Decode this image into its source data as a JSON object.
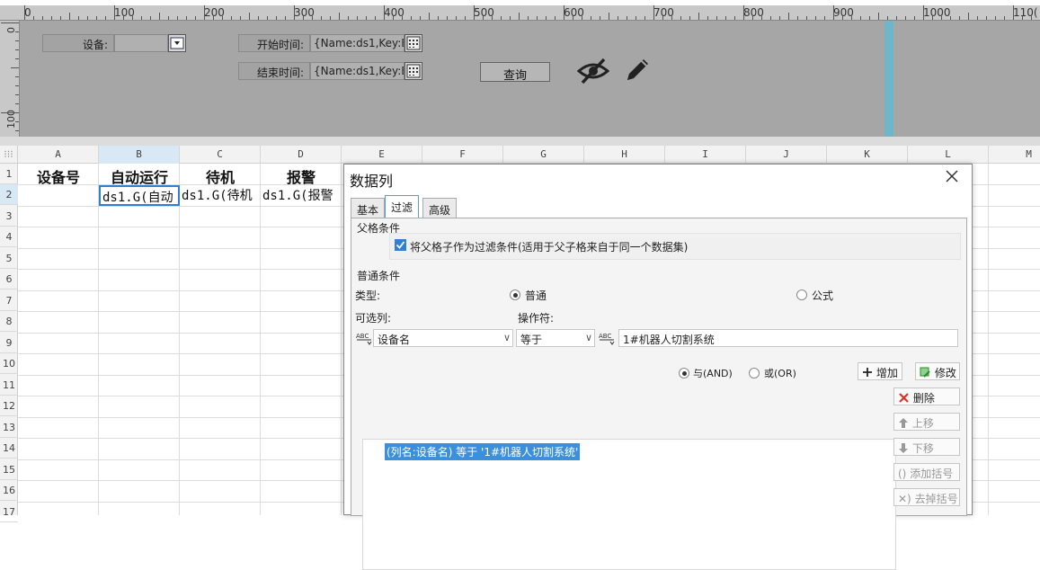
{
  "ruler": {
    "h_labels": [
      "0",
      "100",
      "200",
      "300",
      "400",
      "500",
      "600",
      "700",
      "800",
      "900",
      "1000",
      "110("
    ],
    "v_labels": [
      "0",
      "100"
    ]
  },
  "params": {
    "device_label": "设备:",
    "device_value": "",
    "start_label": "开始时间:",
    "start_value": "{Name:ds1,Key:E",
    "end_label": "结束时间:",
    "end_value": "{Name:ds1,Key:E",
    "query_label": "查询"
  },
  "sheet": {
    "columns": [
      "A",
      "B",
      "C",
      "D",
      "E",
      "F",
      "G",
      "H",
      "I",
      "J",
      "K",
      "L",
      "M"
    ],
    "rows": [
      "1",
      "2",
      "3",
      "4",
      "5",
      "6",
      "7",
      "8",
      "9",
      "10",
      "11",
      "12",
      "13",
      "14",
      "15",
      "16",
      "17"
    ],
    "header_cells": [
      "设备号",
      "自动运行",
      "待机",
      "报警"
    ],
    "data_cells": [
      "ds1.G(自动",
      "ds1.G(待机",
      "ds1.G(报警"
    ]
  },
  "dialog": {
    "title": "数据列",
    "tabs": [
      "基本",
      "过滤",
      "高级"
    ],
    "active_tab": "过滤",
    "parent_section": "父格条件",
    "parent_checkbox": "将父格子作为过滤条件(适用于父子格来自于同一个数据集)",
    "normal_section": "普通条件",
    "type_label": "类型:",
    "type_normal": "普通",
    "type_formula": "公式",
    "column_label": "可选列:",
    "operator_label": "操作符:",
    "column_value": "设备名",
    "operator_value": "等于",
    "condition_value": "1#机器人切割系统",
    "and_label": "与(AND)",
    "or_label": "或(OR)",
    "add_label": "增加",
    "modify_label": "修改",
    "delete_label": "删除",
    "up_label": "上移",
    "down_label": "下移",
    "add_bracket_label": "添加括号",
    "remove_bracket_label": "去掉括号",
    "condition_item": "(列名:设备名) 等于 '1#机器人切割系统'"
  },
  "colors": {
    "param_bg": "#a6a6a6",
    "accent": "#3c8fdb",
    "delete_red": "#d9342b",
    "blue_bar": "#6fb6c8"
  },
  "icons": [
    "hide-eye-icon",
    "pencil-icon",
    "calendar-icon",
    "dropdown-icon",
    "close-icon",
    "plus-icon",
    "edit-icon",
    "x-icon",
    "arrow-up-icon",
    "arrow-down-icon",
    "bracket-icon",
    "remove-bracket-icon",
    "field-type-icon"
  ]
}
